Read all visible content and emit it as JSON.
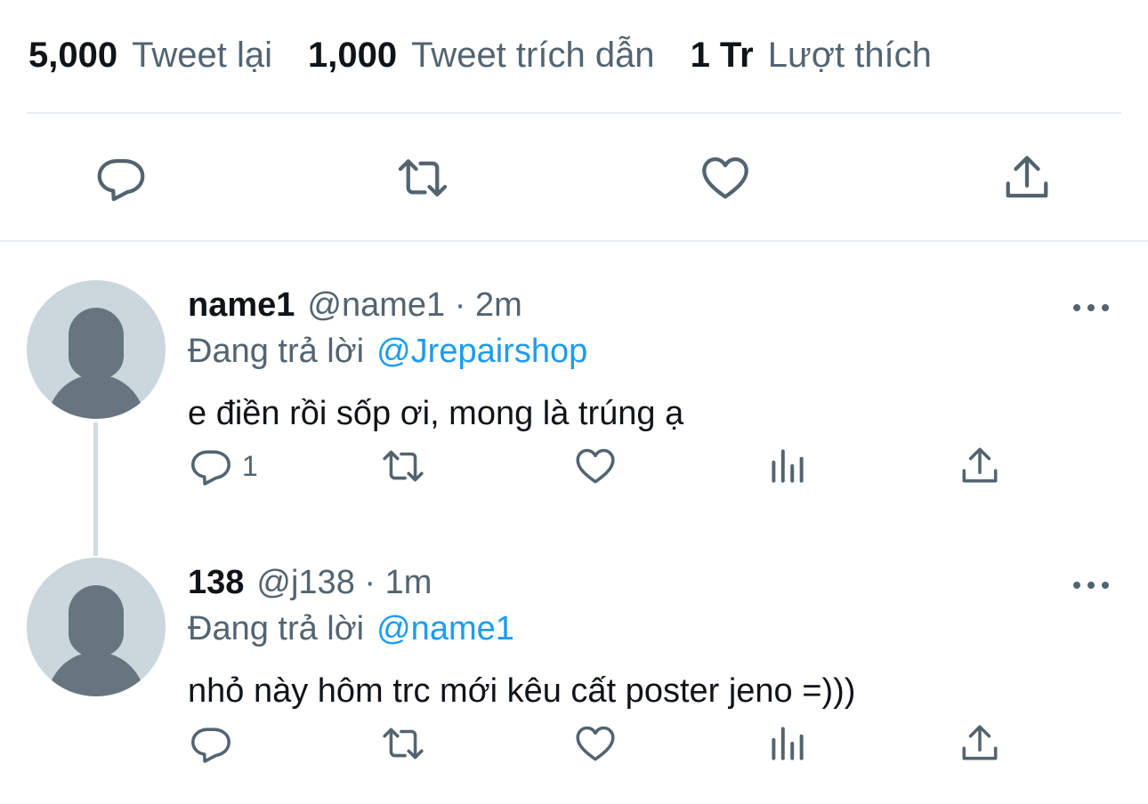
{
  "stats": {
    "retweets": {
      "value": "5,000",
      "label": "Tweet lại"
    },
    "quotes": {
      "value": "1,000",
      "label": "Tweet trích dẫn"
    },
    "likes": {
      "value": "1 Tr",
      "label": "Lượt thích"
    }
  },
  "main_actions": [
    "reply-icon",
    "retweet-icon",
    "like-icon",
    "share-icon"
  ],
  "replies": [
    {
      "name": "name1",
      "meta": "@name1 · 2m",
      "replying_prefix": "Đang trả lời",
      "replying_to": "@Jrepairshop",
      "text": "e điền rồi sốp ơi, mong là trúng ạ",
      "reply_count": "1"
    },
    {
      "name": "138",
      "meta": "@j138 · 1m",
      "replying_prefix": "Đang trả lời",
      "replying_to": "@name1",
      "text": "nhỏ này hôm trc mới kêu cất poster jeno =)))",
      "reply_count": ""
    }
  ],
  "colors": {
    "text": "#0f1419",
    "secondary": "#536471",
    "link": "#1d9bf0",
    "divider": "#e6ecf0",
    "avatar_bg": "#ccd6dd",
    "avatar_fg": "#66757f"
  }
}
